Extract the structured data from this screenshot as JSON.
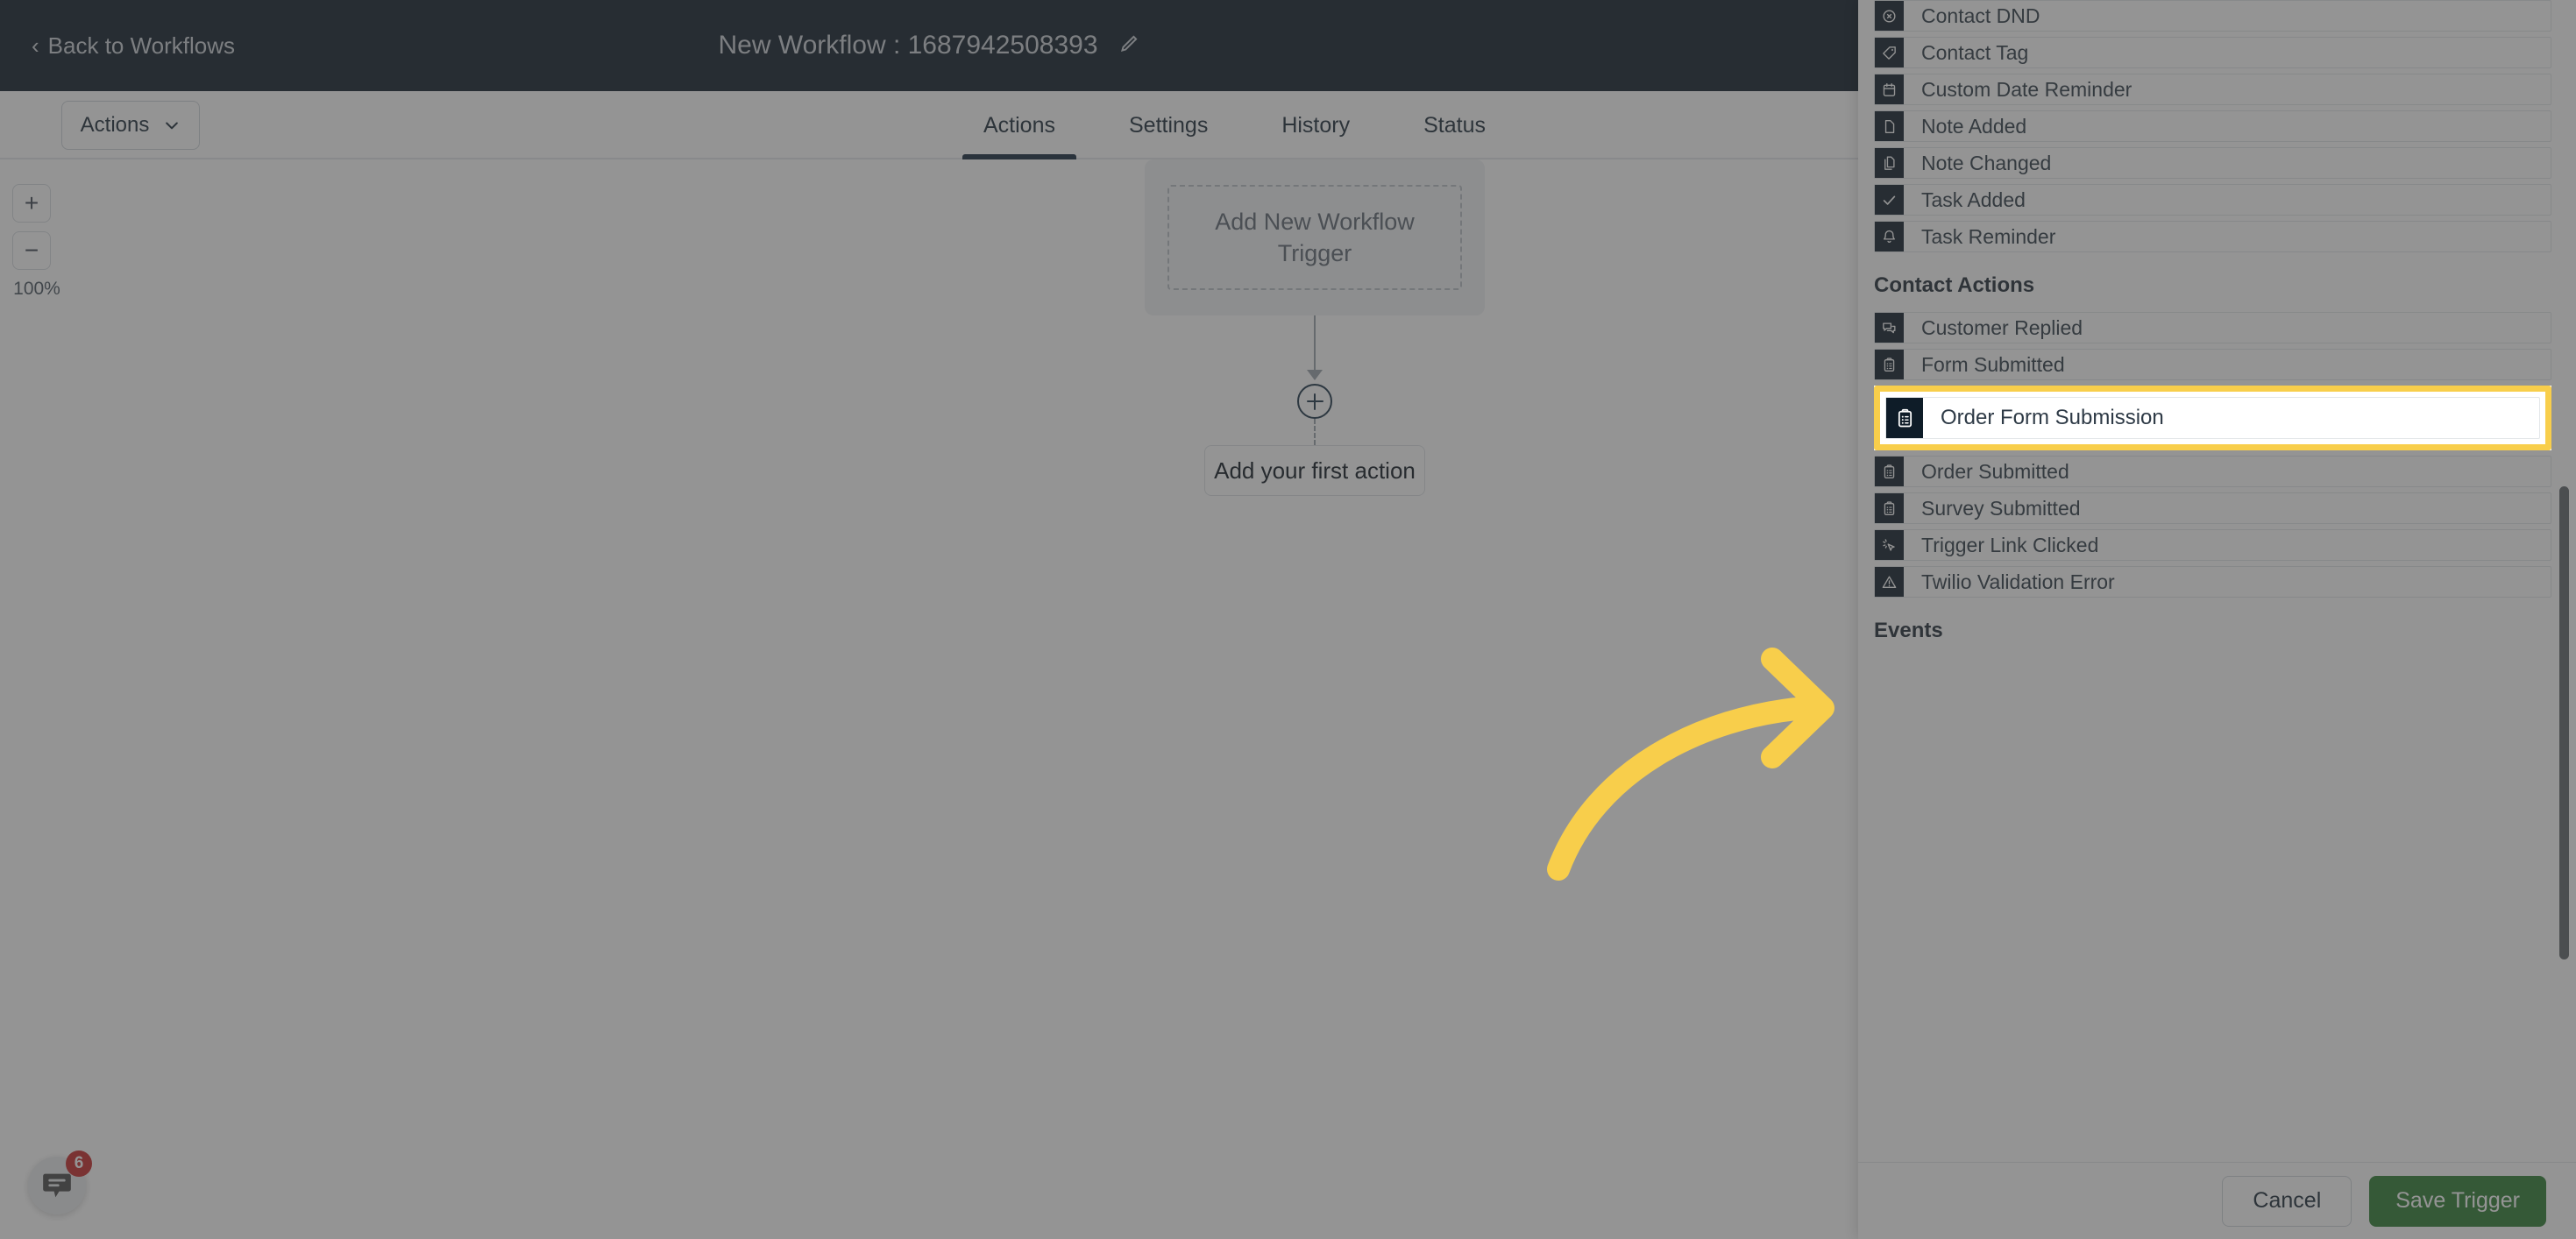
{
  "header": {
    "back_label": "Back to Workflows",
    "back_icon": "chevron-left-icon",
    "workflow_title": "New Workflow : 1687942508393",
    "edit_icon": "pencil-icon"
  },
  "subbar": {
    "actions_dropdown_label": "Actions",
    "chevron_icon": "chevron-down-icon",
    "tabs": [
      {
        "label": "Actions",
        "active": true
      },
      {
        "label": "Settings",
        "active": false
      },
      {
        "label": "History",
        "active": false
      },
      {
        "label": "Status",
        "active": false
      }
    ]
  },
  "canvas": {
    "zoom_in_label": "+",
    "zoom_out_label": "−",
    "zoom_level": "100%",
    "trigger_placeholder": "Add New Workflow Trigger",
    "add_node_icon": "plus-circle-icon",
    "first_action_label": "Add your first action",
    "chat_widget_icon": "chat-bubble-icon",
    "chat_badge_count": "6"
  },
  "panel": {
    "groups": [
      {
        "title": null,
        "items": [
          {
            "label": "Contact DND",
            "icon": "contact-dnd-icon"
          },
          {
            "label": "Contact Tag",
            "icon": "tag-icon"
          },
          {
            "label": "Custom Date Reminder",
            "icon": "calendar-icon"
          },
          {
            "label": "Note Added",
            "icon": "note-icon"
          },
          {
            "label": "Note Changed",
            "icon": "note-copy-icon"
          },
          {
            "label": "Task Added",
            "icon": "check-icon"
          },
          {
            "label": "Task Reminder",
            "icon": "bell-icon"
          }
        ]
      },
      {
        "title": "Contact Actions",
        "items": [
          {
            "label": "Customer Replied",
            "icon": "chat-bubbles-icon"
          },
          {
            "label": "Form Submitted",
            "icon": "clipboard-icon"
          },
          {
            "label": "Order Form Submission",
            "icon": "clipboard-icon",
            "highlighted": true
          },
          {
            "label": "Order Submitted",
            "icon": "clipboard-icon"
          },
          {
            "label": "Survey Submitted",
            "icon": "clipboard-icon"
          },
          {
            "label": "Trigger Link Clicked",
            "icon": "cursor-click-icon"
          },
          {
            "label": "Twilio Validation Error",
            "icon": "warning-triangle-icon"
          }
        ]
      },
      {
        "title": "Events",
        "items": []
      }
    ],
    "footer": {
      "cancel_label": "Cancel",
      "save_label": "Save Trigger"
    }
  },
  "annotation": {
    "arrow_icon": "curved-arrow-right-icon",
    "arrow_color": "#F8CE4B"
  },
  "colors": {
    "header_bg": "#0E1C28",
    "icon_box": "#0E1C28",
    "highlight": "#F8CE4B",
    "save_green": "#2E7D32",
    "badge_red": "#C62828"
  }
}
